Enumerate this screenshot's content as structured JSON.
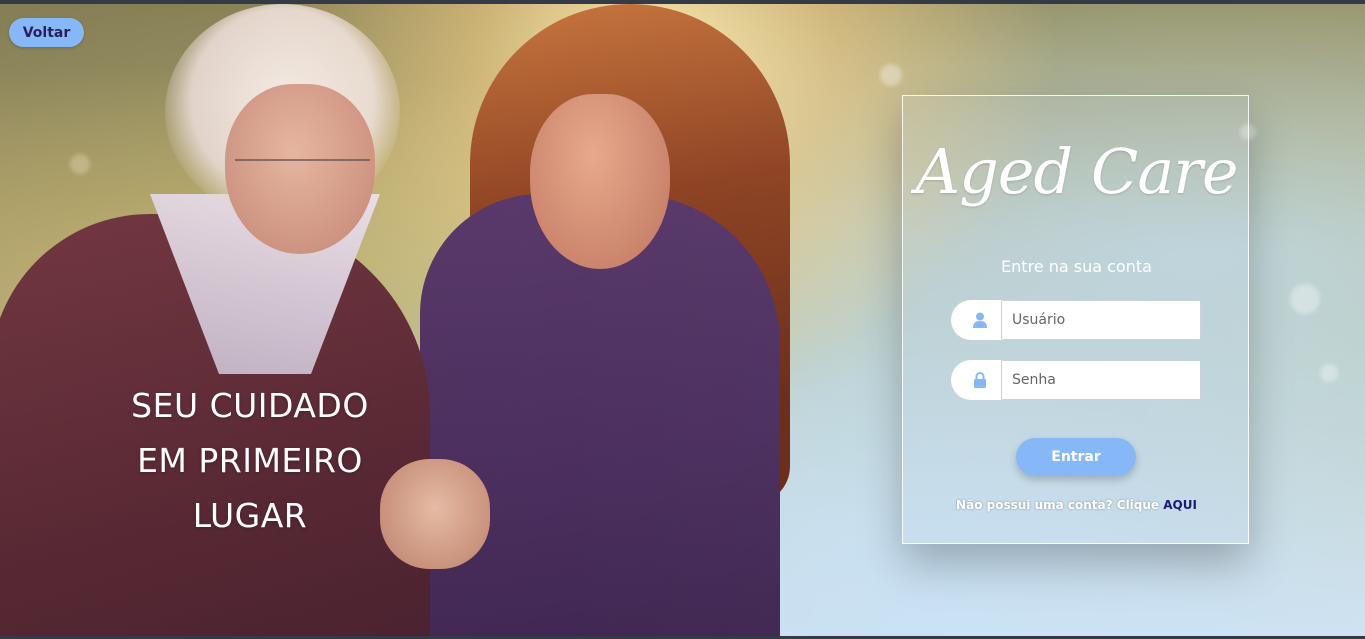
{
  "back_button": {
    "label": "Voltar"
  },
  "hero": {
    "tagline_lines": [
      "SEU CUIDADO",
      "EM PRIMEIRO",
      "LUGAR"
    ]
  },
  "login": {
    "logo": "Aged Care",
    "subtitle": "Entre na sua conta",
    "username_placeholder": "Usuário",
    "username_icon": "user-icon",
    "password_placeholder": "Senha",
    "password_icon": "lock-icon",
    "submit_label": "Entrar",
    "signup_prompt": "Não possui uma conta? Clique",
    "signup_link": "AQUI"
  },
  "colors": {
    "accent": "#86b8f7",
    "link": "#1a1a7a",
    "back_text": "#2a1f5c"
  }
}
